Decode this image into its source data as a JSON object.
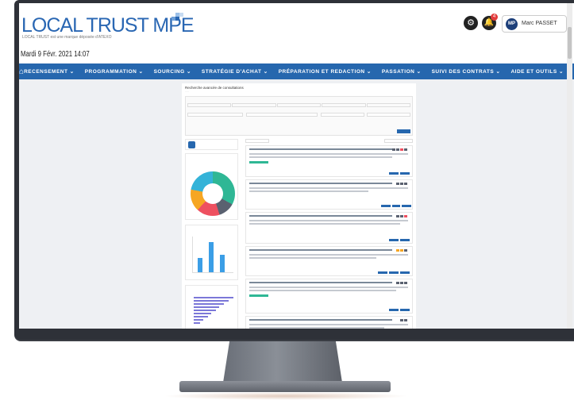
{
  "header": {
    "logo_text": "LOCAL TRUST MPE",
    "tagline": "LOCAL TRUST est une marque déposée d'ATEXO",
    "date": "Mardi 9 Févr. 2021 14:07",
    "notification_count": "4",
    "user": {
      "initials": "MP",
      "name": "Marc PASSET"
    }
  },
  "nav": {
    "items": [
      {
        "label": "RECENSEMENT",
        "caret": "⌄"
      },
      {
        "label": "PROGRAMMATION",
        "caret": "⌄"
      },
      {
        "label": "SOURCING",
        "caret": "⌄"
      },
      {
        "label": "STRATÉGIE D'ACHAT",
        "caret": "⌄"
      },
      {
        "label": "PRÉPARATION ET REDACTION",
        "caret": "⌄"
      },
      {
        "label": "PASSATION",
        "caret": "⌄"
      },
      {
        "label": "SUIVI DES CONTRATS",
        "caret": "⌄"
      },
      {
        "label": "AIDE ET OUTILS",
        "caret": "⌄"
      }
    ]
  },
  "icons": {
    "home": "home-icon",
    "gear": "gear-icon",
    "bell": "bell-icon"
  },
  "colors": {
    "brand": "#2667ae",
    "logo": "#2a67b3",
    "badge": "#e23c3c"
  },
  "panel": {
    "title": "Recherche avancée de consultations"
  }
}
